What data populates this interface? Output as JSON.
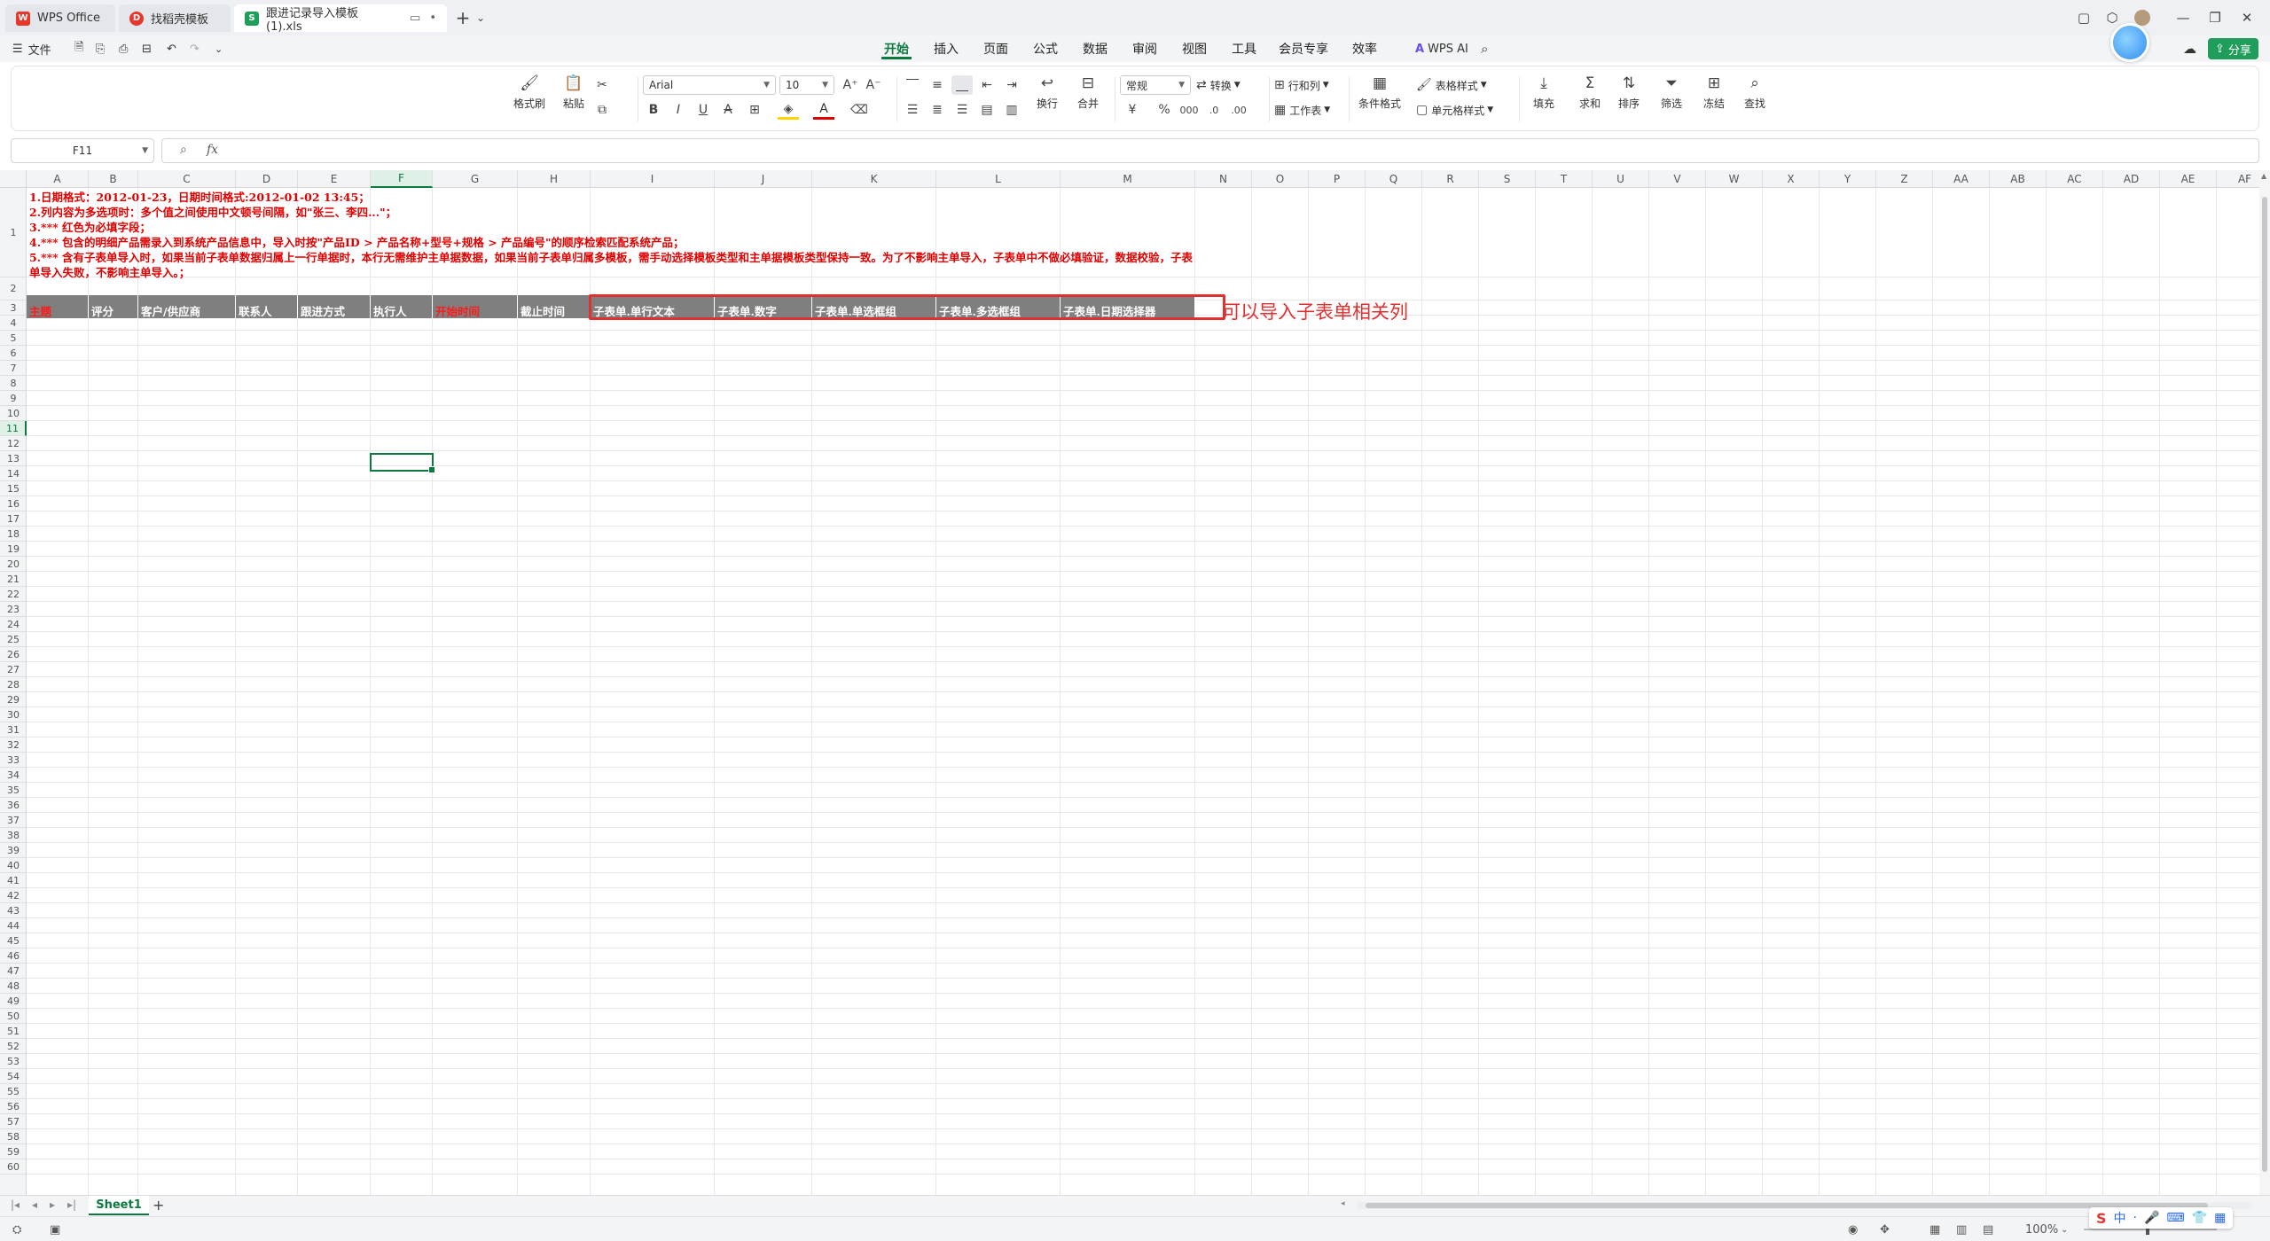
{
  "titlebar": {
    "tabs": [
      {
        "label": "WPS Office",
        "logo": "W",
        "color": "#e8362a"
      },
      {
        "label": "找稻壳模板",
        "logo": "D",
        "color": "#e8362a"
      },
      {
        "label": "跟进记录导入模板 (1).xls",
        "logo": "S",
        "color": "#1e9e5a"
      }
    ],
    "new_tab": "+",
    "more": "⌄"
  },
  "menu": {
    "file": "文件",
    "tabs": [
      "开始",
      "插入",
      "页面",
      "公式",
      "数据",
      "审阅",
      "视图",
      "工具",
      "会员专享",
      "效率"
    ],
    "active_tab": "开始",
    "ai_label": "WPS AI",
    "share": "分享"
  },
  "ribbon": {
    "format_painter": "格式刷",
    "paste": "粘贴",
    "font_name": "Arial",
    "font_size": "10",
    "wrap": "换行",
    "merge": "合并",
    "number_format": "常规",
    "convert": "转换",
    "rows_cols": "行和列",
    "worksheet": "工作表",
    "cond_format": "条件格式",
    "table_style": "表格样式",
    "cell_style": "单元格样式",
    "fill": "填充",
    "sum": "求和",
    "sort": "排序",
    "filter": "筛选",
    "freeze": "冻结",
    "find": "查找",
    "currency": "¥",
    "percent": "%"
  },
  "formula_bar": {
    "name_box": "F11",
    "fx": "fx",
    "value": ""
  },
  "columns": [
    "A",
    "B",
    "C",
    "D",
    "E",
    "F",
    "G",
    "H",
    "I",
    "J",
    "K",
    "L",
    "M",
    "N",
    "O",
    "P",
    "Q",
    "R",
    "S",
    "T",
    "U",
    "V",
    "W",
    "X",
    "Y",
    "Z",
    "AA",
    "AB",
    "AC",
    "AD",
    "AE",
    "AF"
  ],
  "active_col": "F",
  "row_count": 60,
  "active_row": 11,
  "note_lines": [
    "1.日期格式：2012-01-23，日期时间格式:2012-01-02 13:45；",
    "2.列内容为多选项时：多个值之间使用中文顿号间隔，如\"张三、李四...\"；",
    "3.*** 红色为必填字段；",
    "4.*** 包含的明细产品需录入到系统产品信息中，导入时按\"产品ID > 产品名称+型号+规格 > 产品编号\"的顺序检索匹配系统产品；",
    "5.*** 含有子表单导入时，如果当前子表单数据归属上一行单据时，本行无需维护主单据数据，如果当前子表单归属多模板，需手动选择模板类型和主单据模板类型保持一致。为了不影响主单导入，子表单中不做必填验证，数据校验，子表单导入失败，不影响主单导入。；"
  ],
  "headers": [
    {
      "label": "主题",
      "required": true
    },
    {
      "label": "评分",
      "required": false
    },
    {
      "label": "客户/供应商",
      "required": false
    },
    {
      "label": "联系人",
      "required": false
    },
    {
      "label": "跟进方式",
      "required": false
    },
    {
      "label": "执行人",
      "required": false
    },
    {
      "label": "开始时间",
      "required": true
    },
    {
      "label": "截止时间",
      "required": false
    },
    {
      "label": "子表单.单行文本",
      "required": false
    },
    {
      "label": "子表单.数字",
      "required": false
    },
    {
      "label": "子表单.单选框组",
      "required": false
    },
    {
      "label": "子表单.多选框组",
      "required": false
    },
    {
      "label": "子表单.日期选择器",
      "required": false
    }
  ],
  "annotation": "可以导入子表单相关列",
  "sheets": [
    "Sheet1"
  ],
  "status": {
    "zoom": "100%"
  },
  "colors": {
    "accent": "#0b7a3f",
    "required": "#ff1a1a",
    "annotation": "#e03030",
    "header_bg": "#7f7f7f"
  }
}
